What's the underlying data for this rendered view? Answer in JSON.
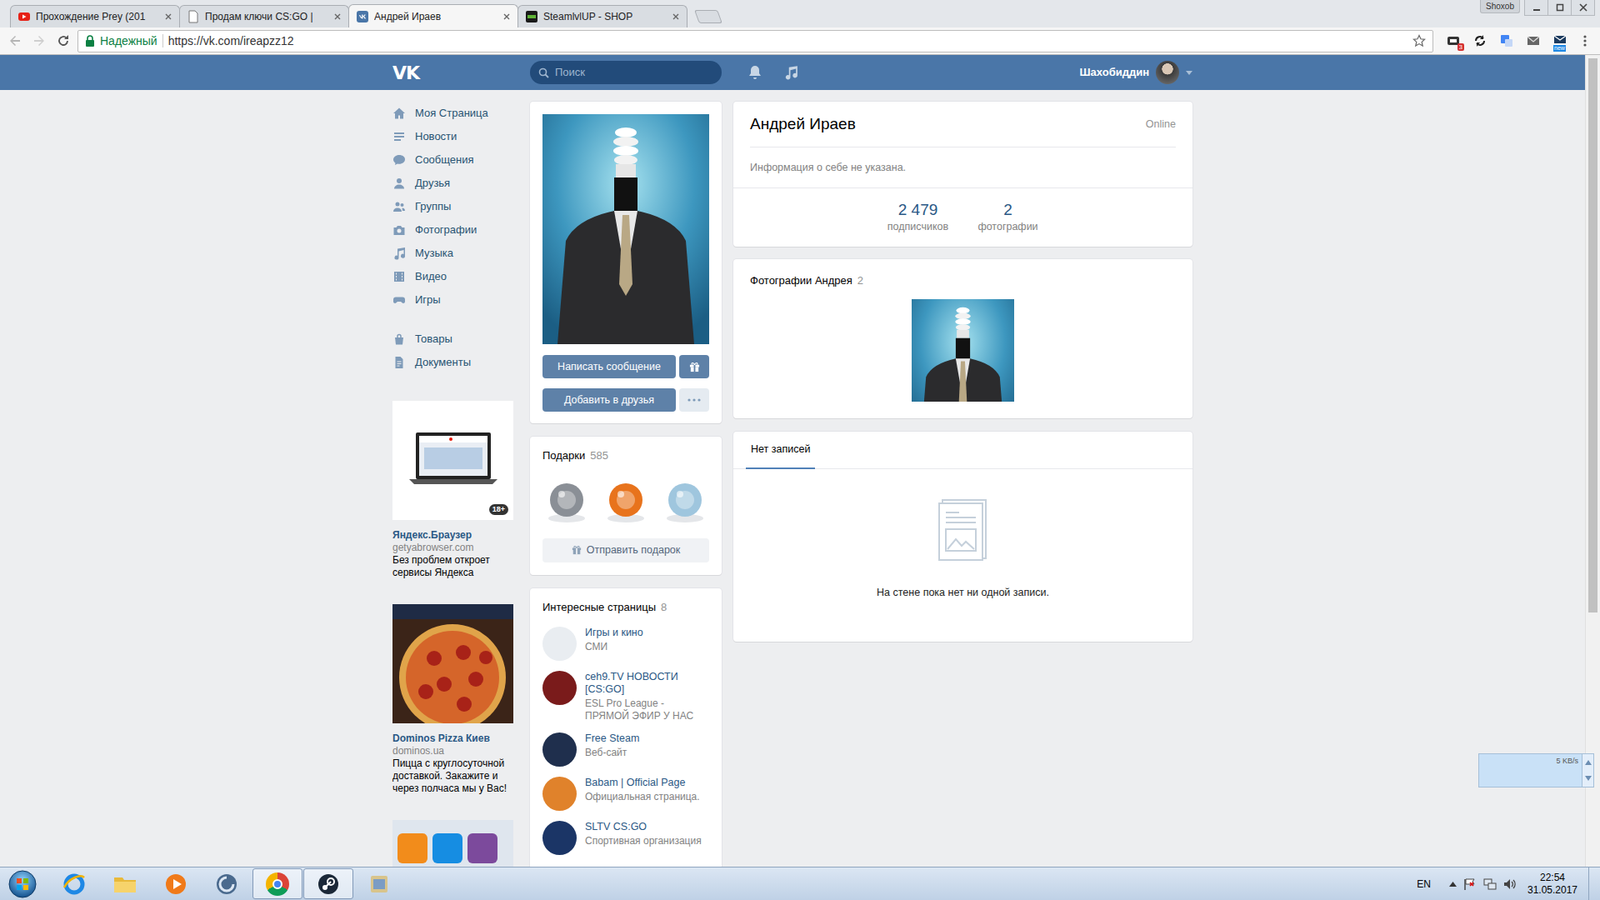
{
  "browser": {
    "tabs": [
      {
        "label": "Прохождение Prey (201",
        "selected": false
      },
      {
        "label": "Продам ключи CS:GO |",
        "selected": false
      },
      {
        "label": "Андрей Ираев",
        "selected": true
      },
      {
        "label": "SteamlvlUP - SHOP",
        "selected": false
      }
    ],
    "profile": "Shoxob",
    "security": "Надежный",
    "url": "https://vk.com/ireapzz12",
    "extension_badge": "3",
    "extension_new": "new"
  },
  "vk": {
    "header": {
      "logo": "VK",
      "search_placeholder": "Поиск",
      "user_name": "Шахобиддин"
    },
    "menu": [
      {
        "label": "Моя Страница"
      },
      {
        "label": "Новости"
      },
      {
        "label": "Сообщения"
      },
      {
        "label": "Друзья"
      },
      {
        "label": "Группы"
      },
      {
        "label": "Фотографии"
      },
      {
        "label": "Музыка"
      },
      {
        "label": "Видео"
      },
      {
        "label": "Игры"
      }
    ],
    "menu_extra": [
      {
        "label": "Товары"
      },
      {
        "label": "Документы"
      }
    ],
    "ads": [
      {
        "title": "Яндекс.Браузер",
        "domain": "getyabrowser.com",
        "text": "Без проблем откроет сервисы Яндекса",
        "age": "18+"
      },
      {
        "title": "Dominos Pizza Киев",
        "domain": "dominos.ua",
        "text": "Пицца с круглосуточной доставкой. Закажите и через полчаса мы у Вас!"
      }
    ],
    "profile": {
      "name": "Андрей Ираев",
      "online": "Online",
      "info": "Информация о себе не указана.",
      "counters": [
        {
          "value": "2 479",
          "label": "подписчиков"
        },
        {
          "value": "2",
          "label": "фотографии"
        }
      ],
      "message_button": "Написать сообщение",
      "add_friend_button": "Добавить в друзья"
    },
    "gifts": {
      "title": "Подарки",
      "count": "585",
      "send": "Отправить подарок",
      "items": [
        {
          "color": "#8a8f96"
        },
        {
          "color": "#e8731c"
        },
        {
          "color": "#9fc6de"
        }
      ]
    },
    "pages": {
      "title": "Интересные страницы",
      "count": "8",
      "items": [
        {
          "name": "Игры и кино",
          "desc": "СМИ",
          "color": "#e9edf1"
        },
        {
          "name": "ceh9.TV НОВОСТИ [CS:GO]",
          "desc": "ESL Pro League - ПРЯМОЙ ЭФИР У НАС",
          "color": "#7a1b1b"
        },
        {
          "name": "Free Steam",
          "desc": "Веб-сайт",
          "color": "#1f2f4d"
        },
        {
          "name": "Babam | Official Page",
          "desc": "Официальная страница.",
          "color": "#e0822b"
        },
        {
          "name": "SLTV CS:GO",
          "desc": "Спортивная организация",
          "color": "#1b3566"
        }
      ]
    },
    "photos": {
      "title": "Фотографии Андрея",
      "count": "2"
    },
    "wall": {
      "tabs": [
        {
          "label": "Нет записей",
          "selected": true
        }
      ],
      "empty": "На стене пока нет ни одной записи."
    }
  },
  "download_widget": {
    "speed": "5 KB/s"
  },
  "taskbar": {
    "apps": [
      {
        "selected": false
      },
      {
        "selected": false
      },
      {
        "selected": false
      },
      {
        "selected": false
      },
      {
        "selected": true
      },
      {
        "selected": true
      },
      {
        "selected": false
      }
    ],
    "language": "EN",
    "time": "22:54",
    "date": "31.05.2017"
  }
}
